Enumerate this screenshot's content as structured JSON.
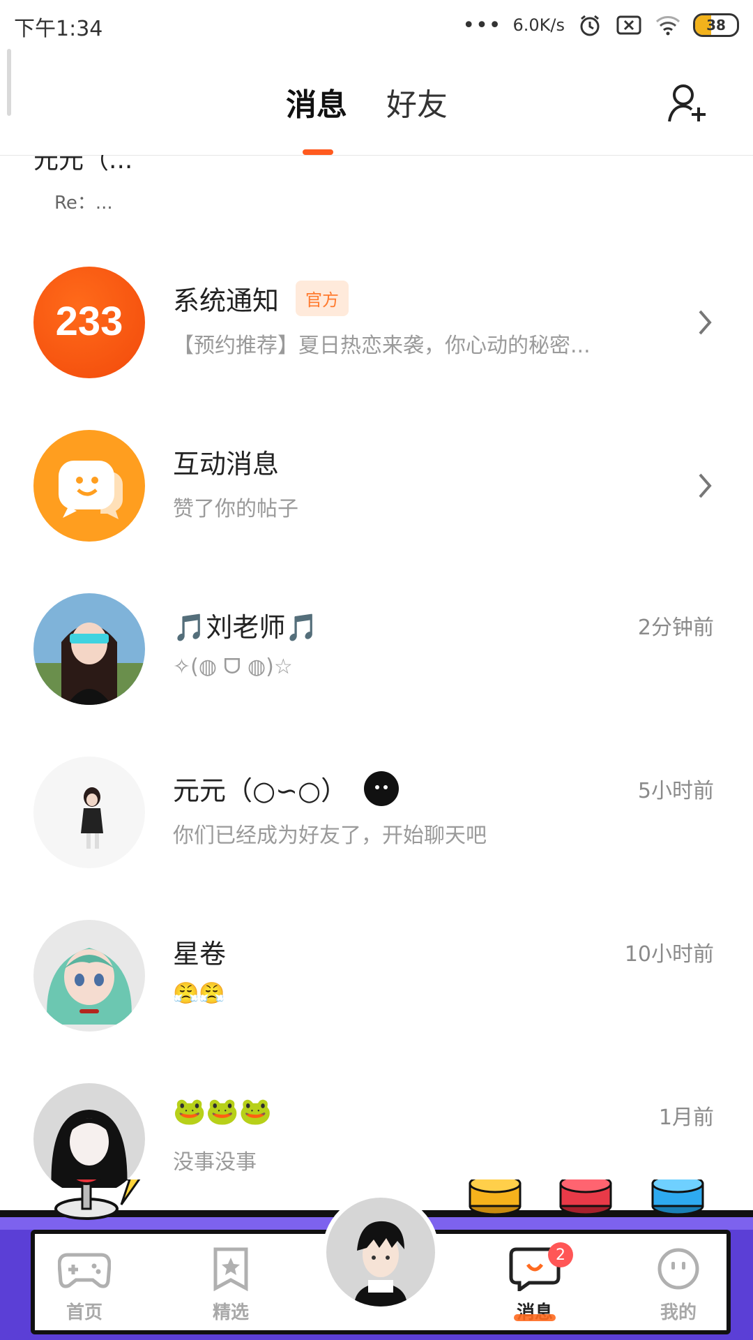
{
  "status_bar": {
    "time": "下午1:34",
    "network_speed": "6.0K/s",
    "battery": "38",
    "battery_level": 0.38,
    "icons": [
      "signal-dots-icon",
      "alarm-icon",
      "sim-off-icon",
      "wifi-icon",
      "battery-icon"
    ]
  },
  "header": {
    "tabs": [
      {
        "label": "消息",
        "active": true
      },
      {
        "label": "好友",
        "active": false
      }
    ],
    "add_friend_icon": "add-user-icon",
    "accent_color": "#ff5a1f"
  },
  "partial_item": {
    "name": "元元（...",
    "message": "Re：..."
  },
  "conversations": [
    {
      "name": "系统通知",
      "tag": "官方",
      "message": "【预约推荐】夏日热恋来袭，你心动的秘密...",
      "time": "",
      "avatar": "233-logo",
      "avatar_text": "233",
      "has_chevron": true
    },
    {
      "name": "互动消息",
      "tag": "",
      "message": "赞了你的帖子",
      "time": "",
      "avatar": "chat-bubble-icon",
      "has_chevron": true
    },
    {
      "name": "🎵刘老师🎵",
      "tag": "",
      "message": "✧(◍ ᗜ ◍)☆",
      "time": "2分钟前",
      "avatar": "user-avatar"
    },
    {
      "name": "元元（○∽○）",
      "tag": "",
      "message": "你们已经成为好友了，开始聊天吧",
      "time": "5小时前",
      "avatar": "user-avatar"
    },
    {
      "name": "星卷",
      "tag": "",
      "message": "😤😤",
      "time": "10小时前",
      "avatar": "user-avatar"
    },
    {
      "name": "🐸🐸🐸",
      "tag": "",
      "message": "没事没事",
      "time": "1月前",
      "avatar": "user-avatar"
    }
  ],
  "bottom_nav": {
    "items": [
      {
        "label": "首页",
        "icon": "gamepad-icon",
        "active": false
      },
      {
        "label": "精选",
        "icon": "star-bookmark-icon",
        "active": false
      },
      {
        "label": "消息",
        "icon": "message-icon",
        "active": true,
        "badge": "2"
      },
      {
        "label": "我的",
        "icon": "smile-face-icon",
        "active": false
      }
    ],
    "background_color": "#5b3fd6"
  }
}
